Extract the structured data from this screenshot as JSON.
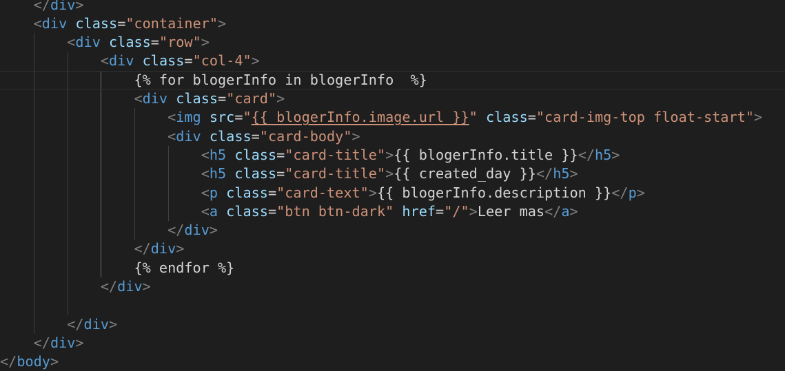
{
  "editor": {
    "language": "html",
    "theme_colors": {
      "background": "#1e1e1e",
      "tag": "#569cd6",
      "attribute": "#9cdcfe",
      "string": "#ce9178",
      "text": "#d4d4d4",
      "punctuation": "#808080"
    },
    "lines": [
      {
        "indent": "    ",
        "tokens": [
          {
            "t": "punc",
            "v": "</"
          },
          {
            "t": "tag",
            "v": "div"
          },
          {
            "t": "punc",
            "v": ">"
          }
        ]
      },
      {
        "indent": "    ",
        "tokens": [
          {
            "t": "punc",
            "v": "<"
          },
          {
            "t": "tag",
            "v": "div"
          },
          {
            "t": "text",
            "v": " "
          },
          {
            "t": "attr",
            "v": "class"
          },
          {
            "t": "text",
            "v": "="
          },
          {
            "t": "str",
            "v": "\"container\""
          },
          {
            "t": "punc",
            "v": ">"
          }
        ]
      },
      {
        "indent": "        ",
        "tokens": [
          {
            "t": "punc",
            "v": "<"
          },
          {
            "t": "tag",
            "v": "div"
          },
          {
            "t": "text",
            "v": " "
          },
          {
            "t": "attr",
            "v": "class"
          },
          {
            "t": "text",
            "v": "="
          },
          {
            "t": "str",
            "v": "\"row\""
          },
          {
            "t": "punc",
            "v": ">"
          }
        ]
      },
      {
        "indent": "            ",
        "tokens": [
          {
            "t": "punc",
            "v": "<"
          },
          {
            "t": "tag",
            "v": "div"
          },
          {
            "t": "text",
            "v": " "
          },
          {
            "t": "attr",
            "v": "class"
          },
          {
            "t": "text",
            "v": "="
          },
          {
            "t": "str",
            "v": "\"col-4\""
          },
          {
            "t": "punc",
            "v": ">"
          }
        ]
      },
      {
        "indent": "                ",
        "current": true,
        "tokens": [
          {
            "t": "text",
            "v": "{% for blogerInfo in blogerInfo  %}"
          }
        ]
      },
      {
        "indent": "                ",
        "tokens": [
          {
            "t": "punc",
            "v": "<"
          },
          {
            "t": "tag",
            "v": "div"
          },
          {
            "t": "text",
            "v": " "
          },
          {
            "t": "attr",
            "v": "class"
          },
          {
            "t": "text",
            "v": "="
          },
          {
            "t": "str",
            "v": "\"card\""
          },
          {
            "t": "punc",
            "v": ">"
          }
        ]
      },
      {
        "indent": "                    ",
        "tokens": [
          {
            "t": "punc",
            "v": "<"
          },
          {
            "t": "tag",
            "v": "img"
          },
          {
            "t": "text",
            "v": " "
          },
          {
            "t": "attr",
            "v": "src"
          },
          {
            "t": "text",
            "v": "="
          },
          {
            "t": "str",
            "v": "\""
          },
          {
            "t": "link",
            "v": "{{ blogerInfo.image.url }}"
          },
          {
            "t": "str",
            "v": "\""
          },
          {
            "t": "text",
            "v": " "
          },
          {
            "t": "attr",
            "v": "class"
          },
          {
            "t": "text",
            "v": "="
          },
          {
            "t": "str",
            "v": "\"card-img-top float-start\""
          },
          {
            "t": "punc",
            "v": ">"
          }
        ]
      },
      {
        "indent": "                    ",
        "tokens": [
          {
            "t": "punc",
            "v": "<"
          },
          {
            "t": "tag",
            "v": "div"
          },
          {
            "t": "text",
            "v": " "
          },
          {
            "t": "attr",
            "v": "class"
          },
          {
            "t": "text",
            "v": "="
          },
          {
            "t": "str",
            "v": "\"card-body\""
          },
          {
            "t": "punc",
            "v": ">"
          }
        ]
      },
      {
        "indent": "                        ",
        "tokens": [
          {
            "t": "punc",
            "v": "<"
          },
          {
            "t": "tag",
            "v": "h5"
          },
          {
            "t": "text",
            "v": " "
          },
          {
            "t": "attr",
            "v": "class"
          },
          {
            "t": "text",
            "v": "="
          },
          {
            "t": "str",
            "v": "\"card-title\""
          },
          {
            "t": "punc",
            "v": ">"
          },
          {
            "t": "text",
            "v": "{{ blogerInfo.title }}"
          },
          {
            "t": "punc",
            "v": "</"
          },
          {
            "t": "tag",
            "v": "h5"
          },
          {
            "t": "punc",
            "v": ">"
          }
        ]
      },
      {
        "indent": "                        ",
        "tokens": [
          {
            "t": "punc",
            "v": "<"
          },
          {
            "t": "tag",
            "v": "h5"
          },
          {
            "t": "text",
            "v": " "
          },
          {
            "t": "attr",
            "v": "class"
          },
          {
            "t": "text",
            "v": "="
          },
          {
            "t": "str",
            "v": "\"card-title\""
          },
          {
            "t": "punc",
            "v": ">"
          },
          {
            "t": "text",
            "v": "{{ created_day }}"
          },
          {
            "t": "punc",
            "v": "</"
          },
          {
            "t": "tag",
            "v": "h5"
          },
          {
            "t": "punc",
            "v": ">"
          }
        ]
      },
      {
        "indent": "                        ",
        "tokens": [
          {
            "t": "punc",
            "v": "<"
          },
          {
            "t": "tag",
            "v": "p"
          },
          {
            "t": "text",
            "v": " "
          },
          {
            "t": "attr",
            "v": "class"
          },
          {
            "t": "text",
            "v": "="
          },
          {
            "t": "str",
            "v": "\"card-text\""
          },
          {
            "t": "punc",
            "v": ">"
          },
          {
            "t": "text",
            "v": "{{ blogerInfo.description }}"
          },
          {
            "t": "punc",
            "v": "</"
          },
          {
            "t": "tag",
            "v": "p"
          },
          {
            "t": "punc",
            "v": ">"
          }
        ]
      },
      {
        "indent": "                        ",
        "tokens": [
          {
            "t": "punc",
            "v": "<"
          },
          {
            "t": "tag",
            "v": "a"
          },
          {
            "t": "text",
            "v": " "
          },
          {
            "t": "attr",
            "v": "class"
          },
          {
            "t": "text",
            "v": "="
          },
          {
            "t": "str",
            "v": "\"btn btn-dark\""
          },
          {
            "t": "text",
            "v": " "
          },
          {
            "t": "attr",
            "v": "href"
          },
          {
            "t": "text",
            "v": "="
          },
          {
            "t": "str",
            "v": "\"/\""
          },
          {
            "t": "punc",
            "v": ">"
          },
          {
            "t": "text",
            "v": "Leer mas"
          },
          {
            "t": "punc",
            "v": "</"
          },
          {
            "t": "tag",
            "v": "a"
          },
          {
            "t": "punc",
            "v": ">"
          }
        ]
      },
      {
        "indent": "                    ",
        "tokens": [
          {
            "t": "punc",
            "v": "</"
          },
          {
            "t": "tag",
            "v": "div"
          },
          {
            "t": "punc",
            "v": ">"
          }
        ]
      },
      {
        "indent": "                ",
        "tokens": [
          {
            "t": "punc",
            "v": "</"
          },
          {
            "t": "tag",
            "v": "div"
          },
          {
            "t": "punc",
            "v": ">"
          }
        ]
      },
      {
        "indent": "                ",
        "tokens": [
          {
            "t": "text",
            "v": "{% endfor %}"
          }
        ]
      },
      {
        "indent": "            ",
        "tokens": [
          {
            "t": "punc",
            "v": "</"
          },
          {
            "t": "tag",
            "v": "div"
          },
          {
            "t": "punc",
            "v": ">"
          }
        ]
      },
      {
        "indent": "",
        "tokens": []
      },
      {
        "indent": "        ",
        "tokens": [
          {
            "t": "punc",
            "v": "</"
          },
          {
            "t": "tag",
            "v": "div"
          },
          {
            "t": "punc",
            "v": ">"
          }
        ]
      },
      {
        "indent": "    ",
        "tokens": [
          {
            "t": "punc",
            "v": "</"
          },
          {
            "t": "tag",
            "v": "div"
          },
          {
            "t": "punc",
            "v": ">"
          }
        ]
      },
      {
        "indent": "",
        "tokens": [
          {
            "t": "punc",
            "v": "</"
          },
          {
            "t": "tag",
            "v": "body"
          },
          {
            "t": "punc",
            "v": ">"
          }
        ]
      }
    ]
  }
}
